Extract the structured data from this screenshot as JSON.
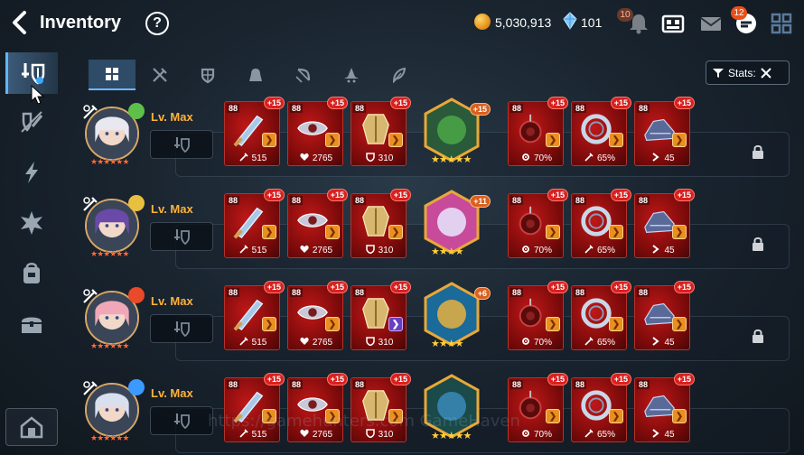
{
  "header": {
    "title": "Inventory",
    "help_label": "?",
    "gold": "5,030,913",
    "crystals": "101",
    "notifications_badge": "10",
    "mail_badge": "12"
  },
  "sidebar": {
    "items": [
      "equipment-tab",
      "sword-off-tab",
      "lightning-tab",
      "burst-tab",
      "bag-tab",
      "chest-tab"
    ],
    "active_index": 0
  },
  "tabs": {
    "items": [
      "all",
      "weapon",
      "helmet",
      "armor",
      "necklace",
      "ring",
      "boots"
    ],
    "active_index": 0,
    "stats_label": "Stats:"
  },
  "rows": [
    {
      "level": "Lv. Max",
      "hero_stars": "★★★★★★",
      "element_color": "#5ec04a",
      "equipment": [
        {
          "lvl": "88",
          "plus": "+15",
          "stat": "515",
          "stat_icon": "sword"
        },
        {
          "lvl": "88",
          "plus": "+15",
          "stat": "2765",
          "stat_icon": "heart"
        },
        {
          "lvl": "88",
          "plus": "+15",
          "stat": "310",
          "stat_icon": "shield"
        },
        {
          "lvl": "88",
          "plus": "+15",
          "stat": "70%",
          "stat_icon": "gear"
        },
        {
          "lvl": "88",
          "plus": "+15",
          "stat": "65%",
          "stat_icon": "sword"
        },
        {
          "lvl": "88",
          "plus": "+15",
          "stat": "45",
          "stat_icon": "speed"
        }
      ],
      "artifact": {
        "plus": "+15",
        "stars": "★★★★★"
      }
    },
    {
      "level": "Lv. Max",
      "hero_stars": "★★★★★★",
      "element_color": "#e8c040",
      "equipment": [
        {
          "lvl": "88",
          "plus": "+15",
          "stat": "515",
          "stat_icon": "sword"
        },
        {
          "lvl": "88",
          "plus": "+15",
          "stat": "2765",
          "stat_icon": "heart"
        },
        {
          "lvl": "88",
          "plus": "+15",
          "stat": "310",
          "stat_icon": "shield"
        },
        {
          "lvl": "88",
          "plus": "+15",
          "stat": "70%",
          "stat_icon": "gear"
        },
        {
          "lvl": "88",
          "plus": "+15",
          "stat": "65%",
          "stat_icon": "sword"
        },
        {
          "lvl": "88",
          "plus": "+15",
          "stat": "45",
          "stat_icon": "speed"
        }
      ],
      "artifact": {
        "plus": "+11",
        "stars": "★★★★"
      }
    },
    {
      "level": "Lv. Max",
      "hero_stars": "★★★★★★",
      "element_color": "#e84a2a",
      "equipment": [
        {
          "lvl": "88",
          "plus": "+15",
          "stat": "515",
          "stat_icon": "sword"
        },
        {
          "lvl": "88",
          "plus": "+15",
          "stat": "2765",
          "stat_icon": "heart"
        },
        {
          "lvl": "88",
          "plus": "+15",
          "stat": "310",
          "stat_icon": "shield"
        },
        {
          "lvl": "88",
          "plus": "+15",
          "stat": "70%",
          "stat_icon": "gear"
        },
        {
          "lvl": "88",
          "plus": "+15",
          "stat": "65%",
          "stat_icon": "sword"
        },
        {
          "lvl": "88",
          "plus": "+15",
          "stat": "45",
          "stat_icon": "speed"
        }
      ],
      "artifact": {
        "plus": "+6",
        "stars": "★★★★"
      }
    },
    {
      "level": "Lv. Max",
      "hero_stars": "★★★★★★",
      "element_color": "#3a9aff",
      "equipment": [
        {
          "lvl": "88",
          "plus": "+15",
          "stat": "515",
          "stat_icon": "sword"
        },
        {
          "lvl": "88",
          "plus": "+15",
          "stat": "2765",
          "stat_icon": "heart"
        },
        {
          "lvl": "88",
          "plus": "+15",
          "stat": "310",
          "stat_icon": "shield"
        },
        {
          "lvl": "88",
          "plus": "+15",
          "stat": "70%",
          "stat_icon": "gear"
        },
        {
          "lvl": "88",
          "plus": "+15",
          "stat": "65%",
          "stat_icon": "sword"
        },
        {
          "lvl": "88",
          "plus": "+15",
          "stat": "45",
          "stat_icon": "speed"
        }
      ],
      "artifact": {
        "plus": "",
        "stars": "★★★★★"
      }
    }
  ],
  "watermark": "https://gamehunters.com GameHaven"
}
